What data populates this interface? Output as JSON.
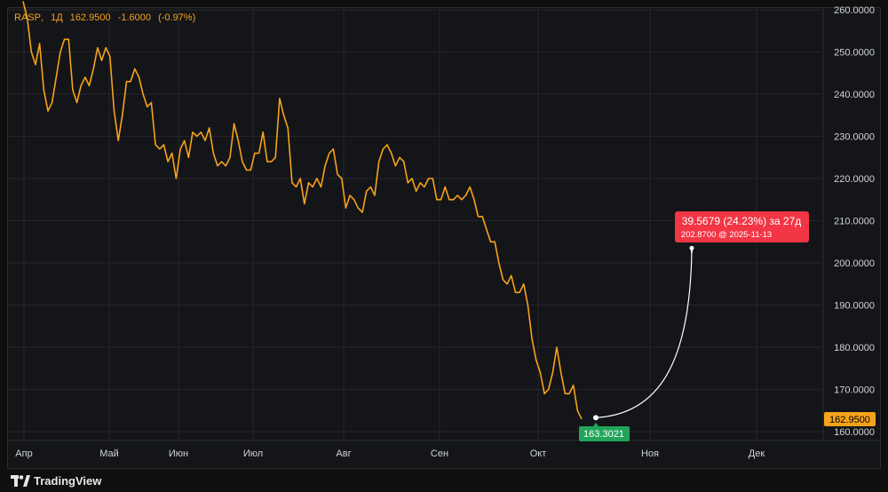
{
  "legend": {
    "symbol": "RASP",
    "interval": "1Д",
    "price": "162.9500",
    "change": "-1.6000",
    "change_pct": "(-0.97%)"
  },
  "brand": "TradingView",
  "colors": {
    "line": "#f7a21b",
    "grid": "#24262b",
    "axis_text": "#d1d4dc",
    "last_price_bg": "#f7a21b",
    "start_label_bg": "#22a55a",
    "target_label_bg": "#f23645",
    "bg": "#141518"
  },
  "chart_data": {
    "type": "line",
    "ylim": [
      158,
      262
    ],
    "yticks": [
      "160.0000",
      "170.0000",
      "180.0000",
      "190.0000",
      "200.0000",
      "210.0000",
      "220.0000",
      "230.0000",
      "240.0000",
      "250.0000",
      "260.0000"
    ],
    "xticks": [
      "Апр",
      "Май",
      "Июн",
      "Июл",
      "Авг",
      "Сен",
      "Окт",
      "Ноя",
      "Дек"
    ],
    "last_price": "162.9500",
    "series": [
      {
        "values": [
          262,
          258,
          250,
          247,
          252,
          241,
          236,
          238,
          244,
          250,
          253,
          253,
          241,
          238,
          242,
          244,
          242,
          246,
          251,
          248,
          251,
          249,
          236,
          229,
          235,
          243,
          243,
          246,
          244,
          240,
          237,
          238,
          228,
          227,
          228,
          224,
          226,
          220,
          227,
          229,
          225,
          231,
          230,
          231,
          229,
          232,
          226,
          223,
          224,
          223,
          225,
          233,
          229,
          224,
          222,
          222,
          226,
          226,
          231,
          224,
          224,
          225,
          239,
          235,
          232,
          219,
          218,
          220,
          214,
          219,
          218,
          220,
          218,
          223,
          226,
          227,
          221,
          220,
          213,
          216,
          215,
          213,
          212,
          217,
          218,
          216,
          224,
          227,
          228,
          226,
          223,
          225,
          224,
          219,
          220,
          217,
          219,
          218,
          220,
          220,
          215,
          215,
          218,
          215,
          215,
          216,
          215,
          216,
          218,
          215,
          211,
          211,
          208,
          205,
          205,
          200,
          196,
          195,
          197,
          193,
          193,
          195,
          190,
          182,
          177,
          174,
          169,
          170,
          174,
          180,
          174,
          169,
          169,
          171,
          165,
          163
        ]
      }
    ],
    "annotation": {
      "start_value": "163.3021",
      "target_value_text": "202.8700",
      "target_date": "2025-11-13",
      "headline": "39.5679 (24.23%) за 27д",
      "start_price": 163.3021,
      "target_price": 202.87
    }
  }
}
